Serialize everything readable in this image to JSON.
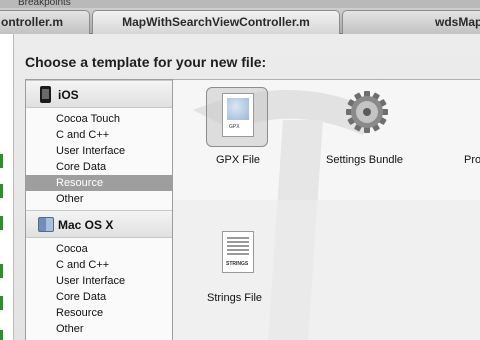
{
  "window": {
    "breakpoints_label": "Breakpoints",
    "tabs": [
      {
        "label": "ontroller.m"
      },
      {
        "label": "MapWithSearchViewController.m"
      },
      {
        "label": "wdsMap"
      }
    ]
  },
  "dialog": {
    "title": "Choose a template for your new file:"
  },
  "sidebar": {
    "sections": [
      {
        "title": "iOS",
        "icon": "iphone-icon",
        "items": [
          "Cocoa Touch",
          "C and C++",
          "User Interface",
          "Core Data",
          "Resource",
          "Other"
        ],
        "selected": "Resource"
      },
      {
        "title": "Mac OS X",
        "icon": "finder-icon",
        "items": [
          "Cocoa",
          "C and C++",
          "User Interface",
          "Core Data",
          "Resource",
          "Other"
        ]
      }
    ]
  },
  "templates": [
    {
      "label": "GPX File",
      "icon": "gpx-file-icon",
      "selected": true,
      "doc_tag": "GPX"
    },
    {
      "label": "Settings Bundle",
      "icon": "settings-gear-icon"
    },
    {
      "label": "Pro",
      "icon": "property-list-icon"
    },
    {
      "label": "Strings File",
      "icon": "strings-file-icon",
      "doc_tag": "STRINGS"
    }
  ],
  "colors": {
    "selection": "#9e9e9e",
    "accent_green": "#2f8f2f"
  }
}
